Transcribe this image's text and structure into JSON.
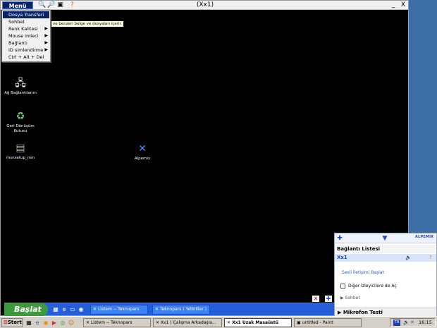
{
  "remote_window": {
    "title": "(Xx1)",
    "menu_label": "Menü",
    "toolbar_icons": [
      "zoom-in-icon",
      "zoom-out-icon",
      "screenshot-icon",
      "help-icon"
    ],
    "help_glyph": "?",
    "minimize": "_",
    "close": "X"
  },
  "context_menu": {
    "items": [
      {
        "label": "Dosya Transferi",
        "selected": true,
        "submenu": false
      },
      {
        "label": "Sohbet",
        "selected": false,
        "submenu": false
      },
      {
        "label": "Renk Kalitesi",
        "selected": false,
        "submenu": true
      },
      {
        "label": "Mouse imleci",
        "selected": false,
        "submenu": true
      },
      {
        "label": "Bağlantı",
        "selected": false,
        "submenu": true
      },
      {
        "label": "ID simlendirme",
        "selected": false,
        "submenu": true
      },
      {
        "label": "Ctrl + Alt + Del",
        "selected": false,
        "submenu": false
      }
    ],
    "tooltip": "ve benzeri belge ve dosyaları içerir."
  },
  "desktop_icons": [
    {
      "label": "Ağ Bağlantılarım",
      "icon": "network-icon"
    },
    {
      "label": "Geri Dönüşüm Kutusu",
      "icon": "recycle-bin-icon"
    },
    {
      "label": "msnsetup_min",
      "icon": "installer-icon"
    },
    {
      "label": "Alpemix",
      "icon": "alpemix-icon"
    }
  ],
  "remote_taskbar": {
    "start_label": "Başlat",
    "tasks": [
      "Listem -- Teknopars",
      "Teknopars ( Yetkililer )"
    ]
  },
  "connection_panel": {
    "brand": "ALPEMIX",
    "title": "Bağlantı Listesi",
    "user": "Xx1",
    "help": "?",
    "voice_link": "Sesli İletişimi Başlat",
    "open_others": "Diğer İzleyicilere de Aç",
    "chat": "Sohbet",
    "mic_test": "Mikrofon Testi"
  },
  "local_taskbar": {
    "start_label": "Start",
    "tasks": [
      {
        "label": "Listem -- Teknopars",
        "active": false
      },
      {
        "label": "Xx1  ( Çalışma Arkadaşla...",
        "active": false
      },
      {
        "label": "Xx1  Uzak Masaüstü",
        "active": true
      },
      {
        "label": "untitled - Paint",
        "active": false
      }
    ],
    "tray_lang": "TR",
    "clock": "16:15"
  },
  "colors": {
    "remote_bg": "#000000",
    "menu_accent": "#0a246a",
    "xp_taskbar": "#245edb",
    "xp_start": "#3c9a3c",
    "link": "#2a5bd7"
  }
}
